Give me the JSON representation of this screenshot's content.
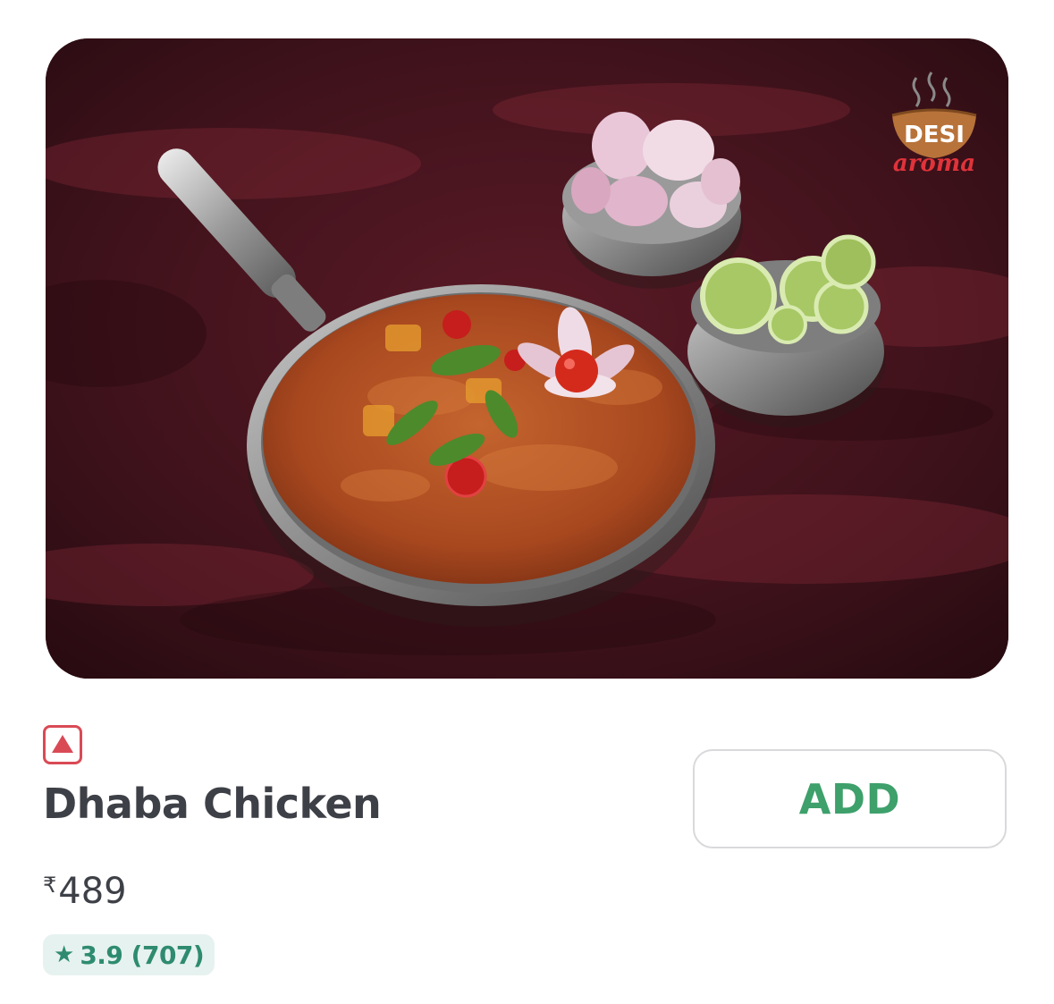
{
  "item": {
    "image_alt": "Dhaba Chicken",
    "brand_logo_name": "desi-aroma-logo",
    "veg_indicator": "non-veg-icon",
    "name": "Dhaba Chicken",
    "price": {
      "currency": "₹",
      "amount": "489"
    },
    "rating": {
      "text": "3.9 (707)"
    }
  },
  "actions": {
    "add_label": "ADD"
  },
  "colors": {
    "non_veg": "#d94a55",
    "rating": "#2e8b6f",
    "rating_bg": "#e6f2ef",
    "add_text": "#3ea06b",
    "title_text": "#3e4047"
  },
  "logo_text": {
    "line1": "DESI",
    "line2": "aroma"
  }
}
